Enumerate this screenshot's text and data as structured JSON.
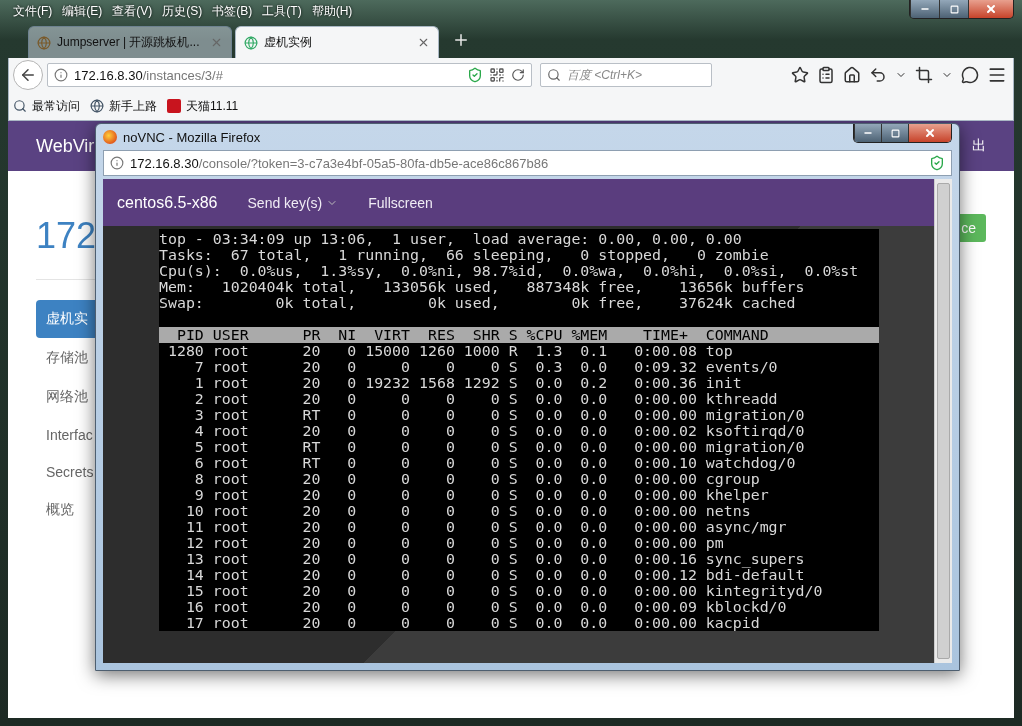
{
  "browser": {
    "menu": [
      "文件(F)",
      "编辑(E)",
      "查看(V)",
      "历史(S)",
      "书签(B)",
      "工具(T)",
      "帮助(H)"
    ],
    "tabs": [
      {
        "title": "Jumpserver | 开源跳板机...",
        "selected": false
      },
      {
        "title": "虚机实例",
        "selected": true
      }
    ],
    "address": {
      "host": "172.16.8.30",
      "path": "/instances/3/#"
    },
    "search": {
      "placeholder": "百度 <Ctrl+K>"
    },
    "bookmarks": [
      "最常访问",
      "新手上路",
      "天猫11.11"
    ]
  },
  "page": {
    "brand": "WebVir",
    "navbar_right": "出",
    "heading": "172",
    "button": "ce",
    "nav": [
      {
        "label": "虚机实",
        "selected": true
      },
      {
        "label": "存储池",
        "selected": false
      },
      {
        "label": "网络池",
        "selected": false
      },
      {
        "label": "Interfac",
        "selected": false
      },
      {
        "label": "Secrets",
        "selected": false
      },
      {
        "label": "概览",
        "selected": false
      }
    ]
  },
  "popup": {
    "title": "noVNC - Mozilla Firefox",
    "address": {
      "host": "172.16.8.30",
      "path": "/console/?token=3-c7a3e4bf-05a5-80fa-db5e-ace86c867b86"
    },
    "vnc": {
      "name": "centos6.5-x86",
      "send_keys": "Send key(s)",
      "fullscreen": "Fullscreen"
    },
    "terminal": {
      "summary": [
        "top - 03:34:09 up 13:06,  1 user,  load average: 0.00, 0.00, 0.00",
        "Tasks:  67 total,   1 running,  66 sleeping,   0 stopped,   0 zombie",
        "Cpu(s):  0.0%us,  1.3%sy,  0.0%ni, 98.7%id,  0.0%wa,  0.0%hi,  0.0%si,  0.0%st",
        "Mem:   1020404k total,   133056k used,   887348k free,    13656k buffers",
        "Swap:        0k total,        0k used,        0k free,    37624k cached"
      ],
      "header": "  PID USER      PR  NI  VIRT  RES  SHR S %CPU %MEM    TIME+  COMMAND",
      "rows": [
        " 1280 root      20   0 15000 1260 1000 R  1.3  0.1   0:00.08 top",
        "    7 root      20   0     0    0    0 S  0.3  0.0   0:09.32 events/0",
        "    1 root      20   0 19232 1568 1292 S  0.0  0.2   0:00.36 init",
        "    2 root      20   0     0    0    0 S  0.0  0.0   0:00.00 kthreadd",
        "    3 root      RT   0     0    0    0 S  0.0  0.0   0:00.00 migration/0",
        "    4 root      20   0     0    0    0 S  0.0  0.0   0:00.02 ksoftirqd/0",
        "    5 root      RT   0     0    0    0 S  0.0  0.0   0:00.00 migration/0",
        "    6 root      RT   0     0    0    0 S  0.0  0.0   0:00.10 watchdog/0",
        "    8 root      20   0     0    0    0 S  0.0  0.0   0:00.00 cgroup",
        "    9 root      20   0     0    0    0 S  0.0  0.0   0:00.00 khelper",
        "   10 root      20   0     0    0    0 S  0.0  0.0   0:00.00 netns",
        "   11 root      20   0     0    0    0 S  0.0  0.0   0:00.00 async/mgr",
        "   12 root      20   0     0    0    0 S  0.0  0.0   0:00.00 pm",
        "   13 root      20   0     0    0    0 S  0.0  0.0   0:00.16 sync_supers",
        "   14 root      20   0     0    0    0 S  0.0  0.0   0:00.12 bdi-default",
        "   15 root      20   0     0    0    0 S  0.0  0.0   0:00.00 kintegrityd/0",
        "   16 root      20   0     0    0    0 S  0.0  0.0   0:00.09 kblockd/0",
        "   17 root      20   0     0    0    0 S  0.0  0.0   0:00.00 kacpid"
      ]
    }
  }
}
